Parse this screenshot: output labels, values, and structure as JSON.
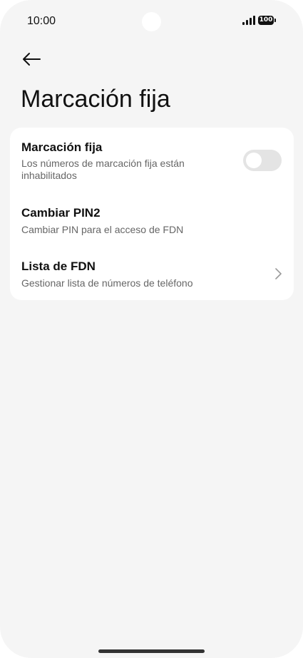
{
  "status_bar": {
    "time": "10:00",
    "battery": "100",
    "signal_icon": "signal-bars-icon",
    "battery_icon": "battery-icon"
  },
  "header": {
    "back_icon": "arrow-left-icon",
    "title": "Marcación fija"
  },
  "settings": {
    "fdn_toggle": {
      "title": "Marcación fija",
      "subtitle": "Los números de marcación fija están inhabilitados",
      "enabled": false
    },
    "change_pin2": {
      "title": "Cambiar PIN2",
      "subtitle": "Cambiar PIN para el acceso de FDN"
    },
    "fdn_list": {
      "title": "Lista de FDN",
      "subtitle": "Gestionar lista de números de teléfono",
      "icon": "chevron-right-icon"
    }
  },
  "colors": {
    "background": "#f5f5f5",
    "card": "#ffffff",
    "toggle_off": "#e4e4e4",
    "text_primary": "#111111",
    "text_secondary": "#666666"
  }
}
